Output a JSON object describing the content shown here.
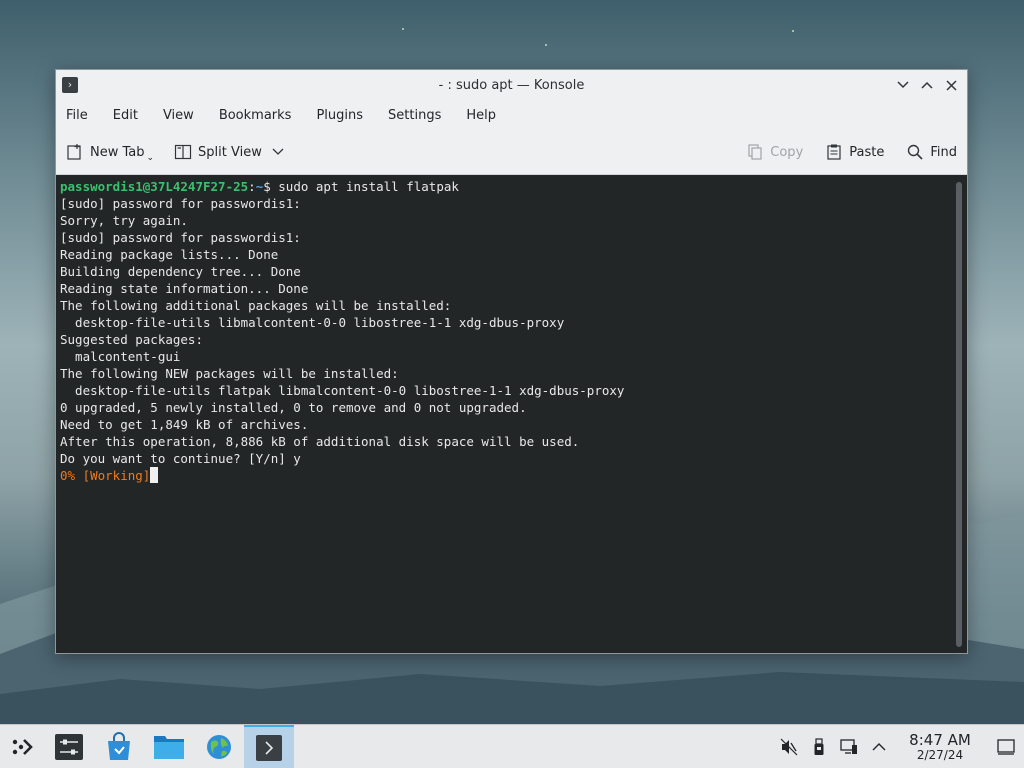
{
  "window": {
    "title": "- : sudo apt — Konsole",
    "controls": [
      "minimize",
      "maximize",
      "close"
    ]
  },
  "menu": [
    "File",
    "Edit",
    "View",
    "Bookmarks",
    "Plugins",
    "Settings",
    "Help"
  ],
  "toolbar": {
    "new_tab": "New Tab",
    "split_view": "Split View",
    "copy": "Copy",
    "paste": "Paste",
    "find": "Find"
  },
  "terminal": {
    "prompt_user": "passwordis1@37L4247F27-25",
    "prompt_sep": ":",
    "prompt_path": "~",
    "prompt_symbol": "$",
    "command": " sudo apt install flatpak",
    "lines": [
      "[sudo] password for passwordis1:",
      "Sorry, try again.",
      "[sudo] password for passwordis1:",
      "Reading package lists... Done",
      "Building dependency tree... Done",
      "Reading state information... Done",
      "The following additional packages will be installed:",
      "  desktop-file-utils libmalcontent-0-0 libostree-1-1 xdg-dbus-proxy",
      "Suggested packages:",
      "  malcontent-gui",
      "The following NEW packages will be installed:",
      "  desktop-file-utils flatpak libmalcontent-0-0 libostree-1-1 xdg-dbus-proxy",
      "0 upgraded, 5 newly installed, 0 to remove and 0 not upgraded.",
      "Need to get 1,849 kB of archives.",
      "After this operation, 8,886 kB of additional disk space will be used.",
      "Do you want to continue? [Y/n] y"
    ],
    "progress": "0% [Working]"
  },
  "taskbar": {
    "apps": [
      "application-launcher",
      "system-settings",
      "discover",
      "dolphin",
      "web-browser",
      "konsole"
    ],
    "active_app": "konsole",
    "tray": [
      "volume-muted",
      "usb-device",
      "network",
      "expand-tray"
    ],
    "time": "8:47 AM",
    "date": "2/27/24"
  },
  "colors": {
    "terminal_bg": "#232627",
    "prompt_user": "#39c16d",
    "prompt_path": "#4aa3e0",
    "progress": "#f27a1a",
    "accent": "#3daee9"
  }
}
